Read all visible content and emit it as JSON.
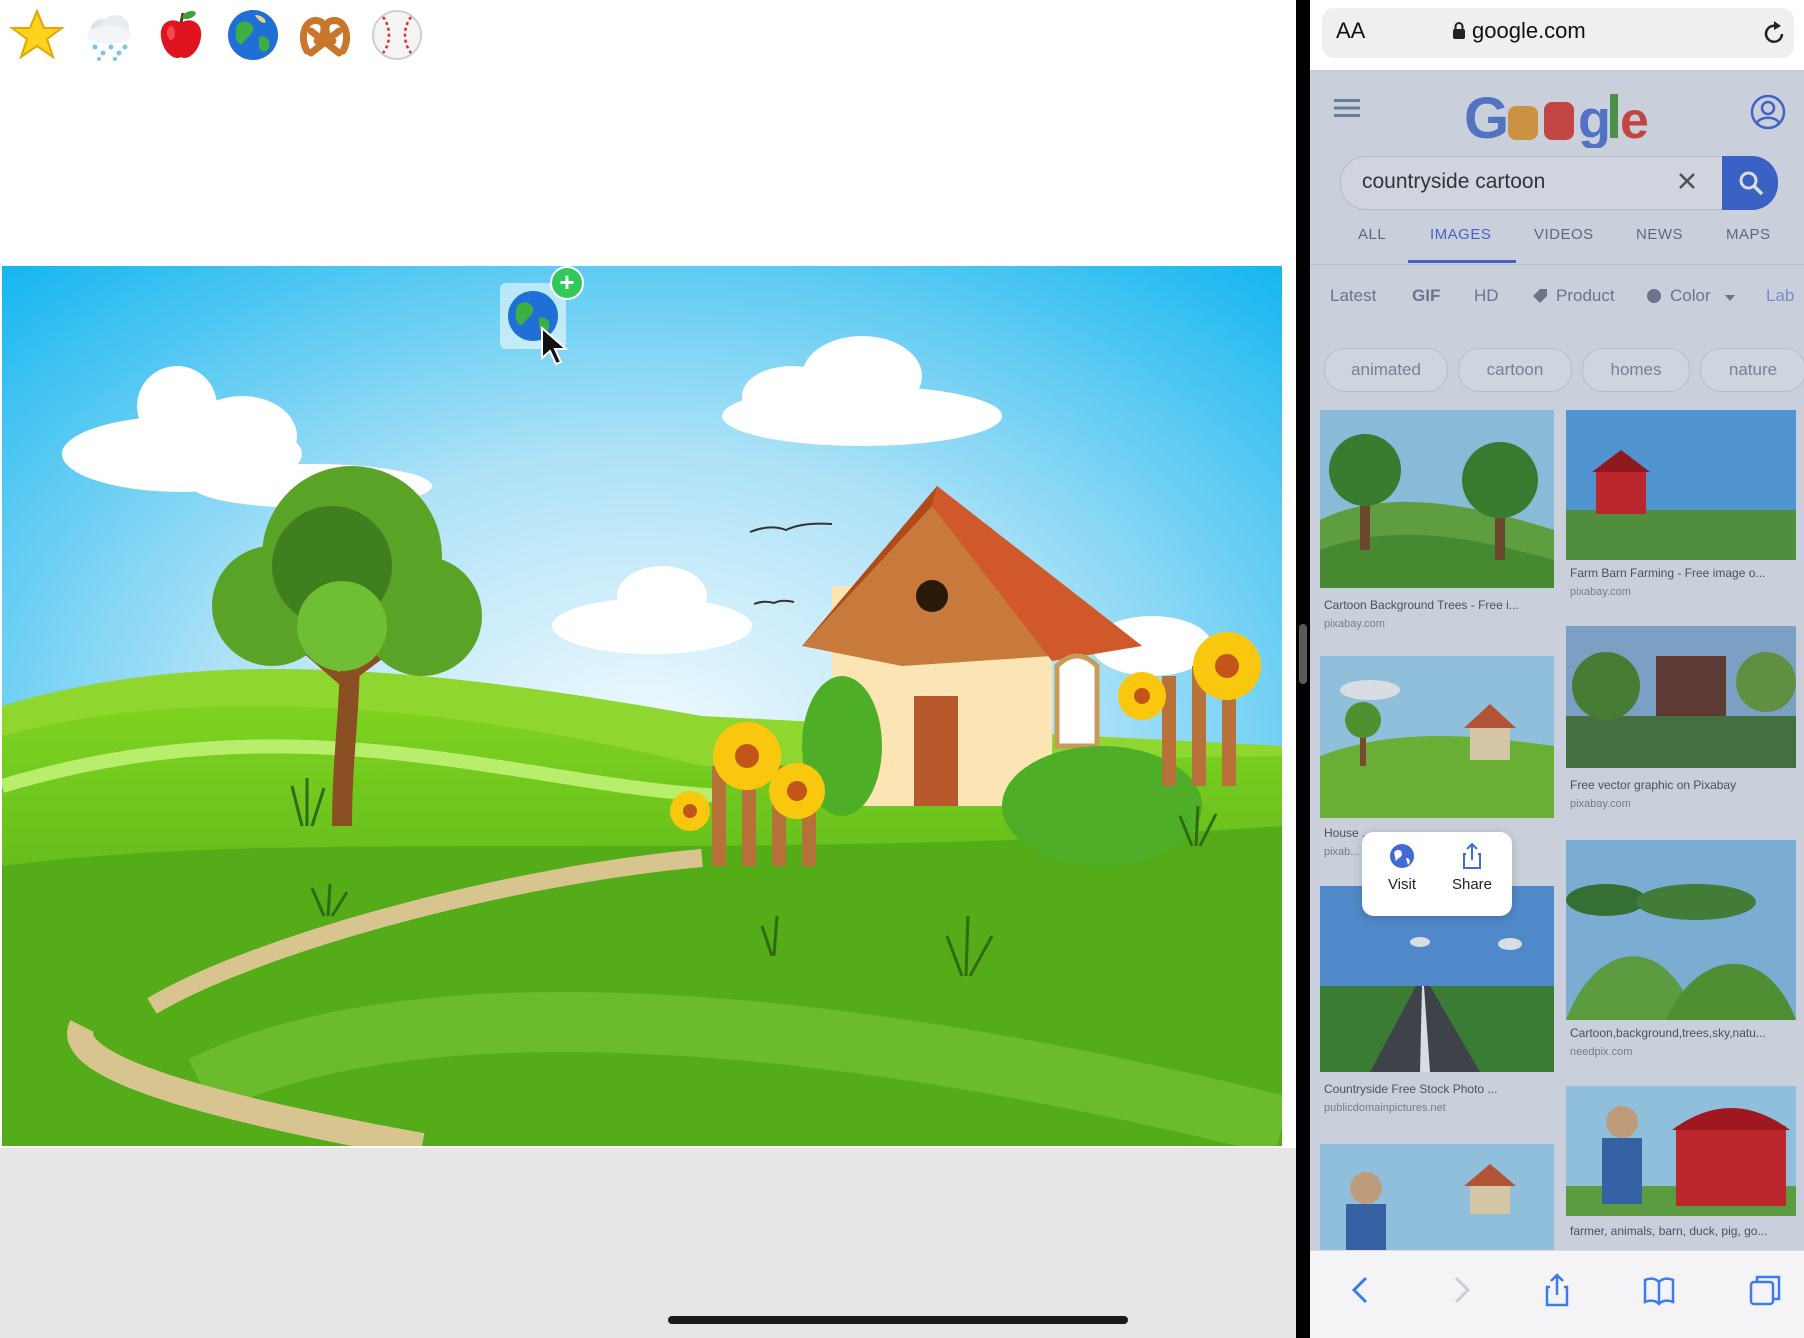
{
  "emoji_bar": {
    "items": [
      {
        "icon": "star-icon"
      },
      {
        "icon": "cloud-snow-icon"
      },
      {
        "icon": "apple-icon"
      },
      {
        "icon": "globe-icon"
      },
      {
        "icon": "pretzel-icon"
      },
      {
        "icon": "baseball-icon"
      }
    ]
  },
  "canvas": {
    "background_image": "countryside-cartoon",
    "dragged_item": "globe-icon"
  },
  "browser": {
    "text_size_label": "AA",
    "url": "google.com",
    "search_query": "countryside cartoon",
    "tabs": [
      "ALL",
      "IMAGES",
      "VIDEOS",
      "NEWS",
      "MAPS"
    ],
    "active_tab": "IMAGES",
    "filters": [
      "Latest",
      "GIF",
      "HD",
      "Product",
      "Color",
      "Lab"
    ],
    "chips": [
      "animated",
      "cartoon",
      "homes",
      "nature"
    ],
    "results": [
      {
        "caption": "Cartoon Background Trees - Free i...",
        "source": "pixabay.com"
      },
      {
        "caption": "Farm Barn Farming - Free image o...",
        "source": "pixabay.com"
      },
      {
        "caption": "House ... e - F...",
        "source": "pixab..."
      },
      {
        "caption": "Free vector graphic on Pixabay",
        "source": "pixabay.com"
      },
      {
        "caption": "Countryside Free Stock Photo ...",
        "source": "publicdomainpictures.net"
      },
      {
        "caption": "Cartoon,background,trees,sky,natu...",
        "source": "needpix.com"
      },
      {
        "caption": "",
        "source": ""
      },
      {
        "caption": "farmer, animals, barn, duck, pig, go...",
        "source": ""
      }
    ],
    "popup": {
      "visit_label": "Visit",
      "share_label": "Share"
    }
  },
  "colors": {
    "accent": "#4a6bd8",
    "search_button": "#3f6ad8",
    "plus_badge": "#34c759"
  }
}
